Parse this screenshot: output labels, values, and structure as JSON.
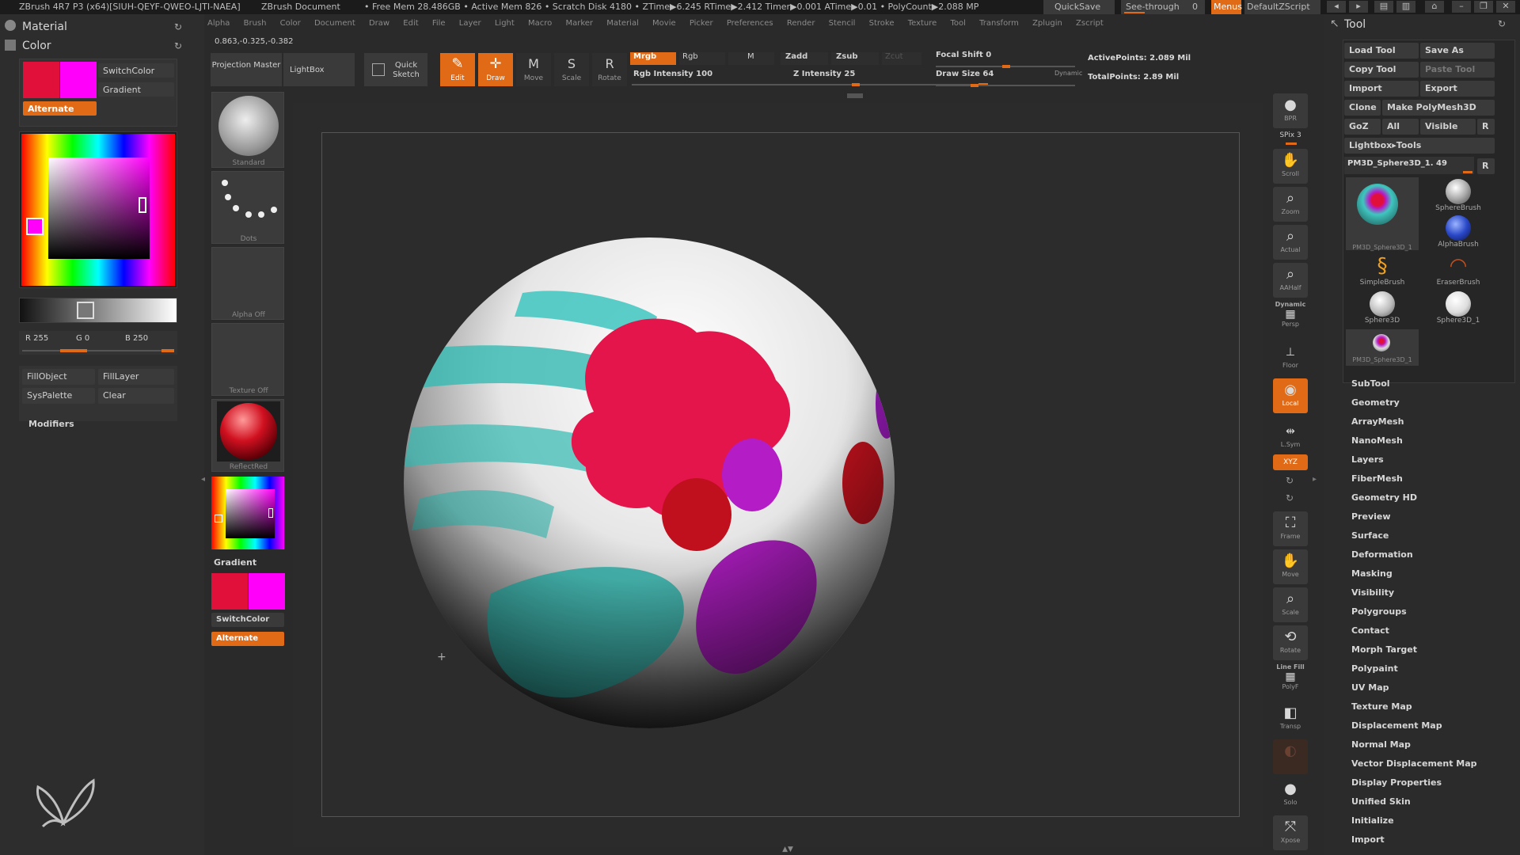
{
  "titlebar": {
    "app": "ZBrush 4R7 P3 (x64)[SIUH-QEYF-QWEO-LJTI-NAEA]",
    "doc": "ZBrush Document",
    "stats": "• Free Mem 28.486GB • Active Mem 826 • Scratch Disk 4180 • ZTime▶6.245 RTime▶2.412 Timer▶0.001 ATime▶0.01 • PolyCount▶2.088 MP",
    "quicksave": "QuickSave",
    "seethrough": "See-through",
    "seethrough_val": "0",
    "menus": "Menus",
    "script": "DefaultZScript"
  },
  "menubar": [
    "Alpha",
    "Brush",
    "Color",
    "Document",
    "Draw",
    "Edit",
    "File",
    "Layer",
    "Light",
    "Macro",
    "Marker",
    "Material",
    "Movie",
    "Picker",
    "Preferences",
    "Render",
    "Stencil",
    "Stroke",
    "Texture",
    "Tool",
    "Transform",
    "Zplugin",
    "Zscript"
  ],
  "coords": "0.863,-0.325,-0.382",
  "left_panel": {
    "material": "Material",
    "color": "Color",
    "switchcolor": "SwitchColor",
    "gradient": "Gradient",
    "alternate": "Alternate",
    "r_label": "R 255",
    "g_label": "G 0",
    "b_label": "B 250",
    "fillobject": "FillObject",
    "filllayer": "FillLayer",
    "syspalette": "SysPalette",
    "clear": "Clear",
    "modifiers": "Modifiers",
    "main_color": "#e0103a",
    "secondary_color": "#ff00fa"
  },
  "top_toolbar": {
    "projection_master": "Projection Master",
    "lightbox": "LightBox",
    "quick_sketch": "Quick Sketch",
    "edit": "Edit",
    "draw": "Draw",
    "move": "Move",
    "scale": "Scale",
    "rotate": "Rotate",
    "mrgb": "Mrgb",
    "rgb": "Rgb",
    "m": "M",
    "zadd": "Zadd",
    "zsub": "Zsub",
    "zcut": "Zcut",
    "rgb_intensity": "Rgb Intensity 100",
    "z_intensity": "Z Intensity 25",
    "focal_shift": "Focal Shift 0",
    "draw_size": "Draw Size 64",
    "dynamic": "Dynamic",
    "active_points": "ActivePoints: 2.089 Mil",
    "total_points": "TotalPoints: 2.89 Mil"
  },
  "shelf": {
    "standard": "Standard",
    "dots": "Dots",
    "alpha_off": "Alpha Off",
    "texture_off": "Texture Off",
    "reflected": "ReflectRed",
    "gradient": "Gradient",
    "switchcolor": "SwitchColor",
    "alternate": "Alternate"
  },
  "right_shelf": [
    {
      "icon": "bpr-icon",
      "label": "BPR"
    },
    {
      "icon": "spix-icon",
      "label": "SPix 3"
    },
    {
      "icon": "scroll-icon",
      "label": "Scroll"
    },
    {
      "icon": "zoom-icon",
      "label": "Zoom"
    },
    {
      "icon": "actual-icon",
      "label": "Actual"
    },
    {
      "icon": "aahalf-icon",
      "label": "AAHalf"
    },
    {
      "icon": "persp-icon",
      "label": "Persp"
    },
    {
      "icon": "dynamic-icon",
      "label": "Dynamic"
    },
    {
      "icon": "floor-icon",
      "label": "Floor"
    },
    {
      "icon": "local-icon",
      "label": "Local"
    },
    {
      "icon": "lsym-icon",
      "label": "L.Sym"
    },
    {
      "icon": "xyz-icon",
      "label": "XYZ"
    },
    {
      "icon": "frame-icon",
      "label": "Frame"
    },
    {
      "icon": "move-icon",
      "label": "Move"
    },
    {
      "icon": "scale-icon",
      "label": "Scale"
    },
    {
      "icon": "rotate-icon",
      "label": "Rotate"
    },
    {
      "icon": "linefill-icon",
      "label": "Line Fill"
    },
    {
      "icon": "polyf-icon",
      "label": "PolyF"
    },
    {
      "icon": "transp-icon",
      "label": "Transp"
    },
    {
      "icon": "ghost-icon",
      "label": "Ghost"
    },
    {
      "icon": "solo-icon",
      "label": "Solo"
    },
    {
      "icon": "xpose-icon",
      "label": "Xpose"
    }
  ],
  "tool_panel": {
    "title": "Tool",
    "load_tool": "Load Tool",
    "save_as": "Save As",
    "copy_tool": "Copy Tool",
    "paste_tool": "Paste Tool",
    "import": "Import",
    "export": "Export",
    "clone": "Clone",
    "make_polymesh": "Make PolyMesh3D",
    "goz": "GoZ",
    "all": "All",
    "visible": "Visible",
    "r": "R",
    "lightbox_tools": "Lightbox▸Tools",
    "current_tool": "PM3D_Sphere3D_1. 49",
    "thumbs": [
      {
        "label": "PM3D_Sphere3D_1"
      },
      {
        "label": "SphereBrush"
      },
      {
        "label": "AlphaBrush"
      },
      {
        "label": "SimpleBrush"
      },
      {
        "label": "EraserBrush"
      },
      {
        "label": "Sphere3D"
      },
      {
        "label": "Sphere3D_1"
      },
      {
        "label": "PM3D_Sphere3D_1"
      }
    ],
    "sections": [
      "SubTool",
      "Geometry",
      "ArrayMesh",
      "NanoMesh",
      "Layers",
      "FiberMesh",
      "Geometry HD",
      "Preview",
      "Surface",
      "Deformation",
      "Masking",
      "Visibility",
      "Polygroups",
      "Contact",
      "Morph Target",
      "Polypaint",
      "UV Map",
      "Texture Map",
      "Displacement Map",
      "Normal Map",
      "Vector Displacement Map",
      "Display Properties",
      "Unified Skin",
      "Initialize",
      "Import"
    ]
  }
}
